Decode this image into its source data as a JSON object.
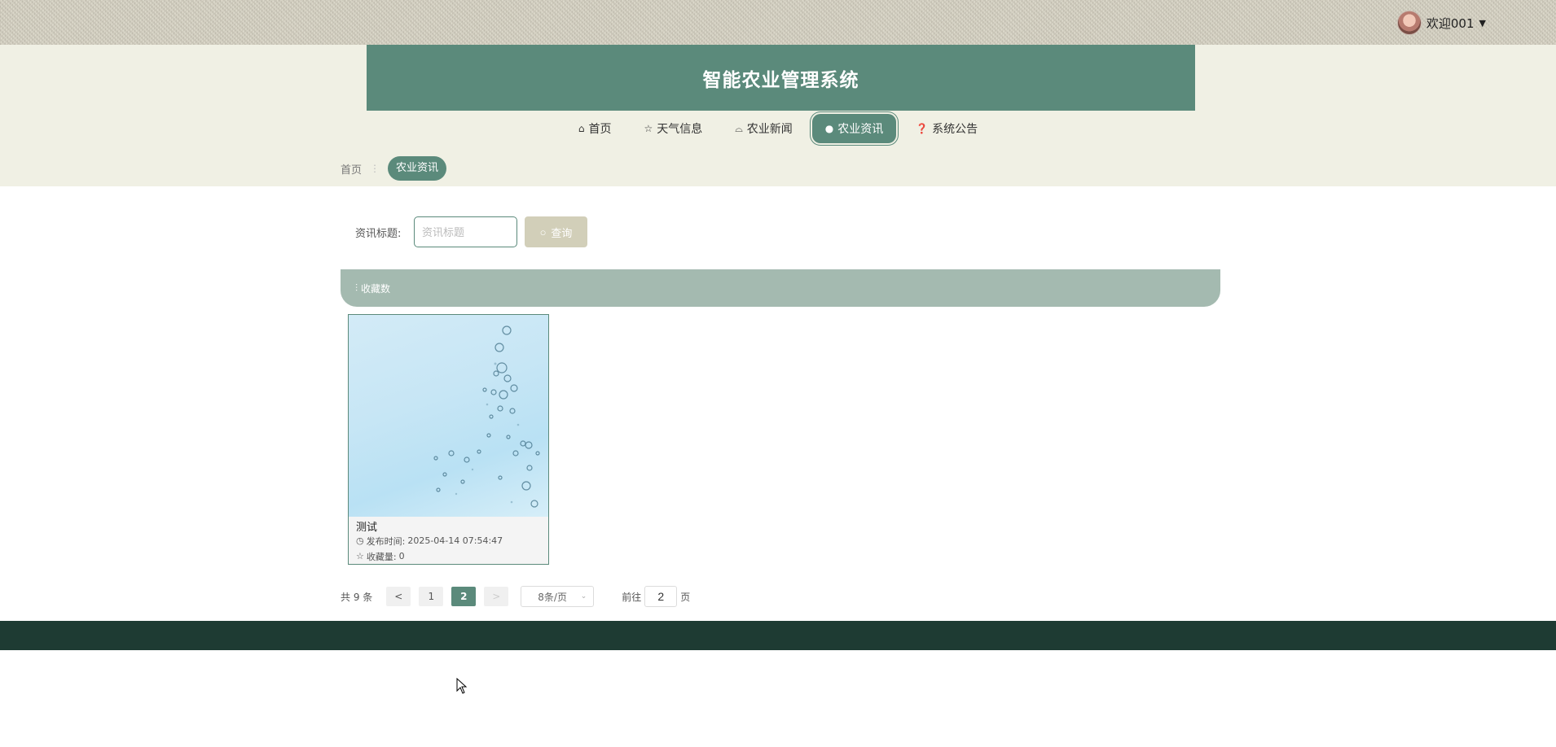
{
  "header": {
    "user_greeting": "欢迎001",
    "app_title": "智能农业管理系统"
  },
  "nav": {
    "items": [
      {
        "label": "首页",
        "icon": "home-icon"
      },
      {
        "label": "天气信息",
        "icon": "star-icon"
      },
      {
        "label": "农业新闻",
        "icon": "bag-icon"
      },
      {
        "label": "农业资讯",
        "icon": "info-icon"
      },
      {
        "label": "系统公告",
        "icon": "question-icon"
      }
    ],
    "active_index": 3
  },
  "breadcrumb": {
    "home": "首页",
    "current": "农业资讯"
  },
  "search": {
    "label": "资讯标题:",
    "placeholder": "资讯标题",
    "value": "",
    "button_label": "查询"
  },
  "sort": {
    "label": "收藏数"
  },
  "cards": [
    {
      "title": "测试",
      "publish_label": "发布时间:",
      "publish_time": "2025-04-14 07:54:47",
      "fav_label": "收藏量:",
      "fav_count": "0"
    }
  ],
  "pagination": {
    "total_text": "共 9 条",
    "prev": "<",
    "next": ">",
    "pages": [
      "1",
      "2"
    ],
    "current_page": "2",
    "page_size": "8条/页",
    "jump_prefix": "前往",
    "jump_value": "2",
    "jump_suffix": "页"
  },
  "colors": {
    "primary": "#5b8a7b",
    "header_bg": "#f0f0e4",
    "sort_bar": "#a4bab0",
    "search_button": "#d2cfb9",
    "footer": "#1e3b33"
  }
}
